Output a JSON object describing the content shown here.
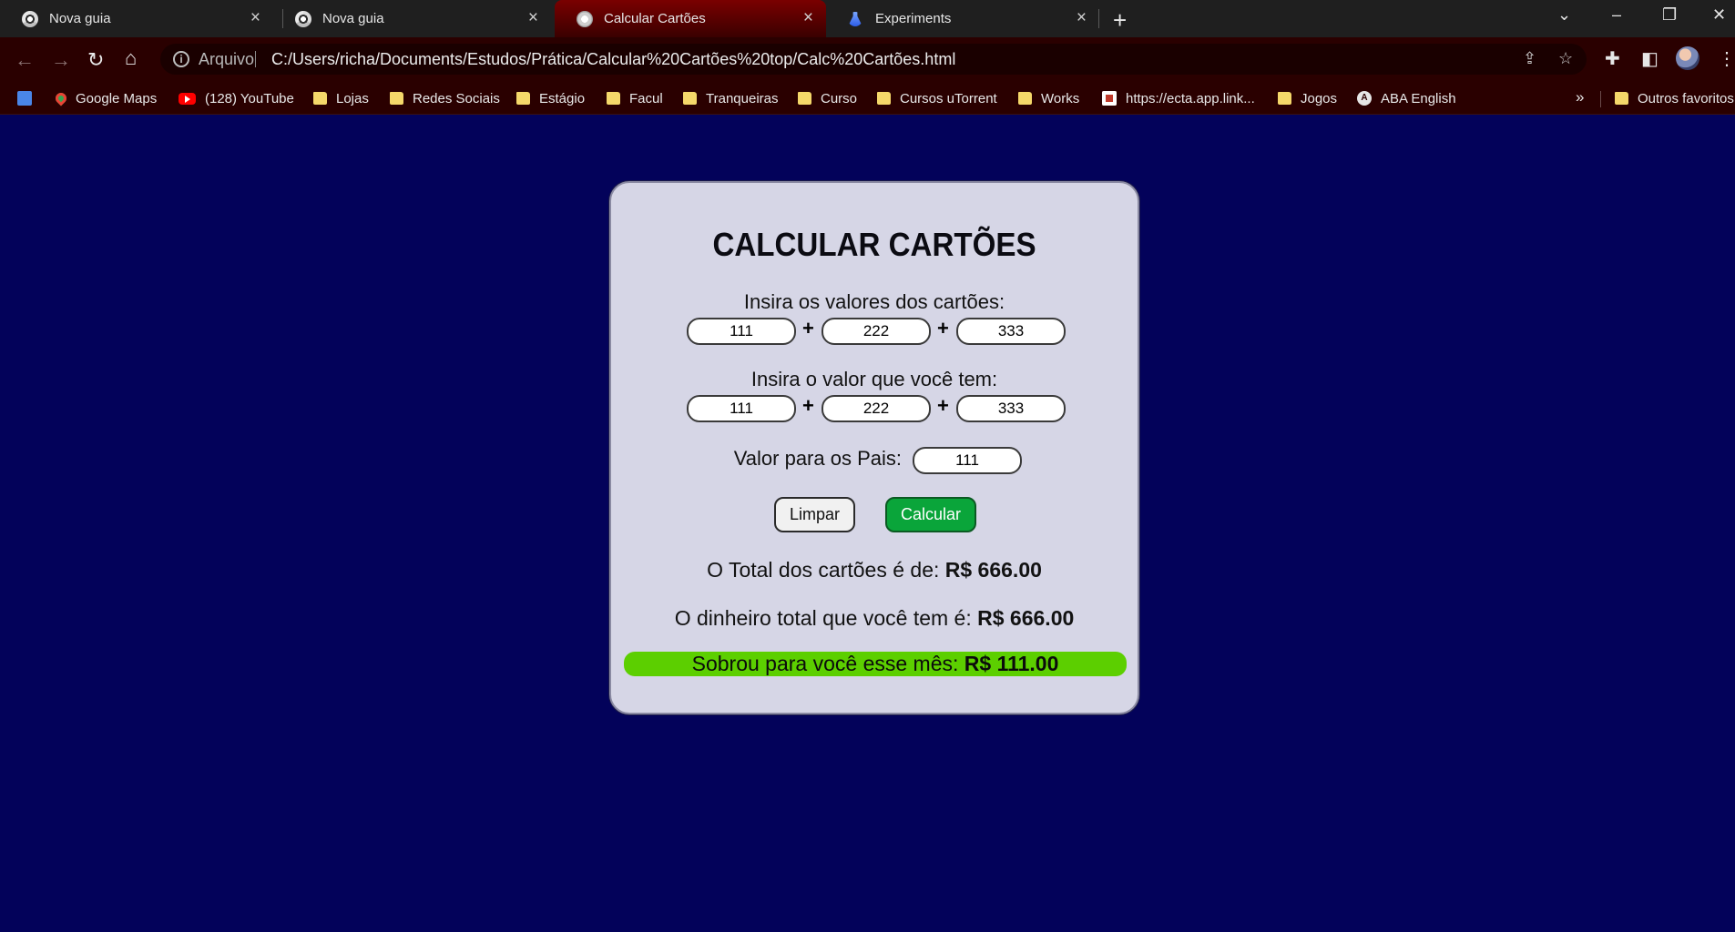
{
  "browser": {
    "tabs": [
      {
        "title": "Nova guia",
        "icon": "chrome-icon",
        "active": false
      },
      {
        "title": "Nova guia",
        "icon": "chrome-icon",
        "active": false
      },
      {
        "title": "Calcular Cartões",
        "icon": "globe-icon",
        "active": true
      },
      {
        "title": "Experiments",
        "icon": "flask-icon",
        "active": false
      }
    ],
    "close_glyph": "×",
    "new_tab_glyph": "+",
    "window_controls": {
      "tab_search": "⌄",
      "minimize": "–",
      "restore": "❐",
      "close": "✕"
    },
    "nav": {
      "back": "←",
      "forward": "→",
      "reload": "↻",
      "home": "⌂"
    },
    "address": {
      "scheme_label": "Arquivo",
      "url": "C:/Users/richa/Documents/Estudos/Prática/Calcular%20Cartões%20top/Calc%20Cartões.html",
      "share_icon": "⇪",
      "bookmark_icon": "☆"
    },
    "toolbar_icons": {
      "extensions": "✚",
      "side_panel": "◧",
      "menu": "⋮"
    },
    "bookmarks": [
      {
        "label": "",
        "icon": "google-translate-icon"
      },
      {
        "label": "Google Maps",
        "icon": "maps-pin-icon"
      },
      {
        "label": "(128) YouTube",
        "icon": "youtube-icon"
      },
      {
        "label": "Lojas",
        "icon": "folder-icon"
      },
      {
        "label": "Redes Sociais",
        "icon": "folder-icon"
      },
      {
        "label": "Estágio",
        "icon": "folder-icon"
      },
      {
        "label": "Facul",
        "icon": "folder-icon"
      },
      {
        "label": "Tranqueiras",
        "icon": "folder-icon"
      },
      {
        "label": "Curso",
        "icon": "folder-icon"
      },
      {
        "label": "Cursos uTorrent",
        "icon": "folder-icon"
      },
      {
        "label": "Works",
        "icon": "folder-icon"
      },
      {
        "label": "https://ecta.app.link...",
        "icon": "ecta-icon"
      },
      {
        "label": "Jogos",
        "icon": "folder-icon"
      },
      {
        "label": "ABA English",
        "icon": "aba-icon"
      }
    ],
    "bookmarks_overflow": "»",
    "other_bookmarks": "Outros favoritos"
  },
  "app": {
    "title": "CALCULAR CARTÕES",
    "cards_label": "Insira os valores dos cartões:",
    "cards_values": [
      "111",
      "222",
      "333"
    ],
    "money_label": "Insira o valor que você tem:",
    "money_values": [
      "111",
      "222",
      "333"
    ],
    "plus": "+",
    "parents_label": "Valor para os Pais:",
    "parents_value": "111",
    "clear_button": "Limpar",
    "calc_button": "Calcular",
    "total_cards_text": "O Total dos cartões é de:",
    "total_cards_value": "R$ 666.00",
    "total_money_text": "O dinheiro total que você tem é:",
    "total_money_value": "R$ 666.00",
    "leftover_text": "Sobrou para você esse mês:",
    "leftover_value": "R$ 111.00",
    "colors": {
      "background": "#03025a",
      "card": "#d6d6e6",
      "calc_button": "#0aa53a",
      "leftover_bar": "#5ccf00"
    }
  }
}
